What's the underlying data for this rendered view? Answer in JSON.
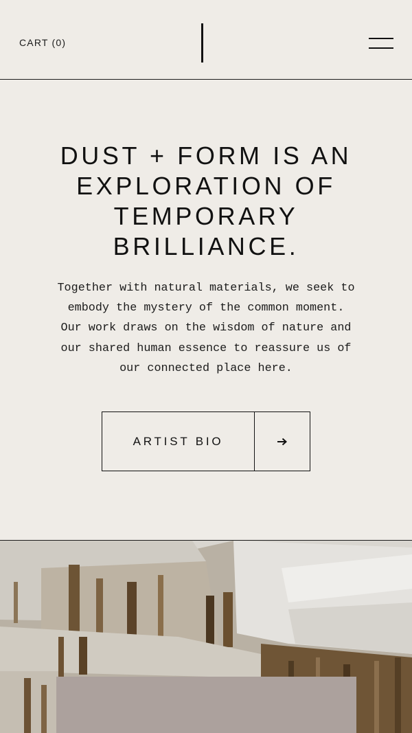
{
  "header": {
    "cart_label": "CART (0)"
  },
  "hero": {
    "headline_lines": [
      "DUST + FORM IS AN",
      "EXPLORATION OF",
      "TEMPORARY",
      "BRILLIANCE."
    ],
    "body_lines": [
      "Together with natural materials, we seek to",
      "embody the mystery of the common moment.",
      "Our work draws on the wisdom of nature and",
      "our shared human essence to reassure us of",
      "our connected place here."
    ],
    "cta_label": "ARTIST BIO"
  },
  "icons": {
    "logo": "vertical-bar-logo",
    "menu": "hamburger-menu-icon",
    "arrow": "arrow-right-icon"
  },
  "colors": {
    "background": "#efece7",
    "text": "#111111",
    "card": "#aca19d"
  }
}
